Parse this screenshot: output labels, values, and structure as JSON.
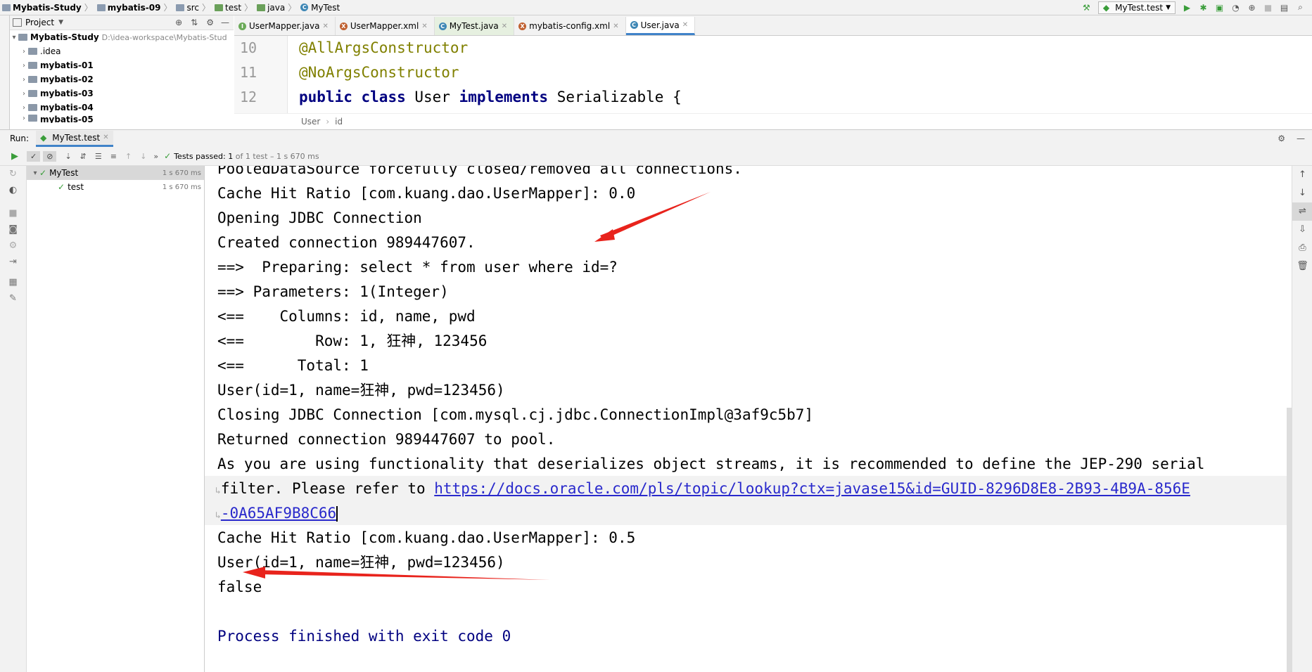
{
  "breadcrumb": [
    "Mybatis-Study",
    "mybatis-09",
    "src",
    "test",
    "java",
    "MyTest"
  ],
  "run_config": "MyTest.test",
  "project_panel": {
    "title": "Project",
    "root_name": "Mybatis-Study",
    "root_path": "D:\\idea-workspace\\Mybatis-Stud",
    "items": [
      ".idea",
      "mybatis-01",
      "mybatis-02",
      "mybatis-03",
      "mybatis-04",
      "mybatis-05"
    ]
  },
  "editor_tabs": [
    {
      "label": "UserMapper.java",
      "icon": "I",
      "color": "#6aaa58"
    },
    {
      "label": "UserMapper.xml",
      "icon": "X",
      "color": "#c06030"
    },
    {
      "label": "MyTest.java",
      "icon": "C",
      "color": "#3e87b5"
    },
    {
      "label": "mybatis-config.xml",
      "icon": "X",
      "color": "#c06030"
    },
    {
      "label": "User.java",
      "icon": "C",
      "color": "#3e87b5"
    }
  ],
  "editor": {
    "line_numbers": [
      "10",
      "11",
      "12"
    ],
    "line10": "@AllArgsConstructor",
    "line11": "@NoArgsConstructor",
    "line12": {
      "kw1": "public",
      "kw2": "class",
      "name": "User",
      "kw3": "implements",
      "rest": "Serializable {"
    },
    "crumbs": [
      "User",
      "id"
    ]
  },
  "run_panel": {
    "label": "Run:",
    "tab": "MyTest.test",
    "status_prefix": "Tests passed:",
    "status_count": "1",
    "status_rest": "of 1 test – 1 s 670 ms",
    "tree": [
      {
        "name": "MyTest",
        "duration": "1 s 670 ms"
      },
      {
        "name": "test",
        "duration": "1 s 670 ms"
      }
    ]
  },
  "console": {
    "lines": [
      "PooledDataSource forcefully closed/removed all connections.",
      "Cache Hit Ratio [com.kuang.dao.UserMapper]: 0.0",
      "Opening JDBC Connection",
      "Created connection 989447607.",
      "==>  Preparing: select * from user where id=?",
      "==> Parameters: 1(Integer)",
      "<==    Columns: id, name, pwd",
      "<==        Row: 1, 狂神, 123456",
      "<==      Total: 1",
      "User(id=1, name=狂神, pwd=123456)",
      "Closing JDBC Connection [com.mysql.cj.jdbc.ConnectionImpl@3af9c5b7]",
      "Returned connection 989447607 to pool.",
      "As you are using functionality that deserializes object streams, it is recommended to define the JEP-290 serial",
      "filter. Please refer to ",
      "-0A65AF9B8C66",
      "Cache Hit Ratio [com.kuang.dao.UserMapper]: 0.5",
      "User(id=1, name=狂神, pwd=123456)",
      "false",
      "",
      "Process finished with exit code 0"
    ],
    "link": "https://docs.oracle.com/pls/topic/lookup?ctx=javase15&id=GUID-8296D8E8-2B93-4B9A-856E"
  }
}
